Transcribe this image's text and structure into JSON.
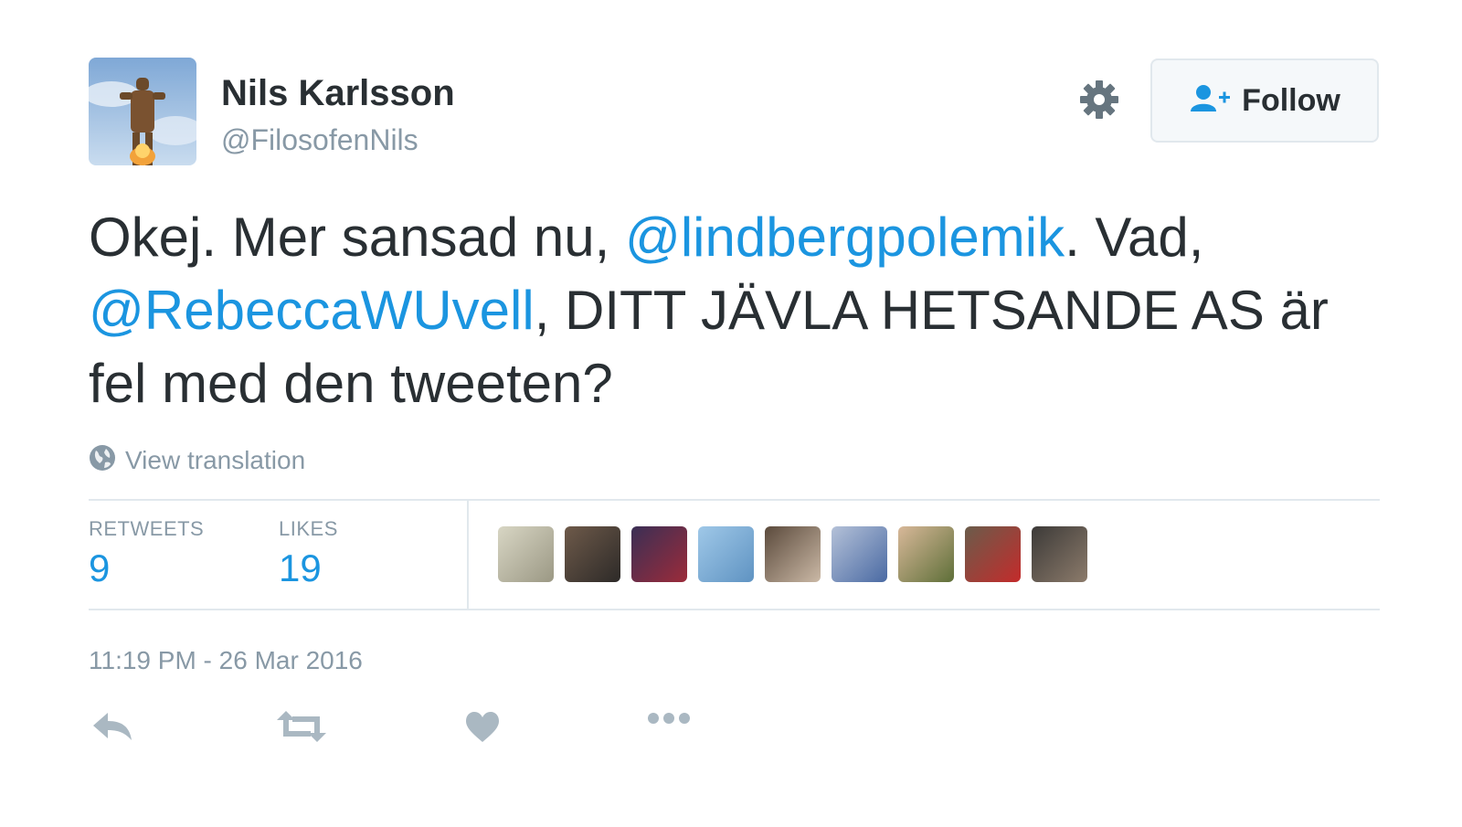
{
  "author": {
    "name": "Nils Karlsson",
    "handle": "@FilosofenNils"
  },
  "header": {
    "follow_label": "Follow"
  },
  "tweet": {
    "parts": {
      "p1": "Okej. Mer sansad nu, ",
      "mention1": "@lindbergpolemik",
      "p2": ". Vad, ",
      "mention2": "@RebeccaWUvell",
      "p3": ", DITT JÄVLA HETSANDE AS är fel med den tweeten?"
    },
    "translation_label": "View translation"
  },
  "stats": {
    "retweets_label": "RETWEETS",
    "retweets_count": "9",
    "likes_label": "LIKES",
    "likes_count": "19"
  },
  "timestamp": "11:19 PM - 26 Mar 2016",
  "actions": [
    "reply-icon",
    "retweet-icon",
    "like-icon",
    "more-icon"
  ],
  "colors": {
    "link": "#1b95e0",
    "text": "#292f33",
    "muted": "#8899a6",
    "border": "#e1e8ed"
  }
}
